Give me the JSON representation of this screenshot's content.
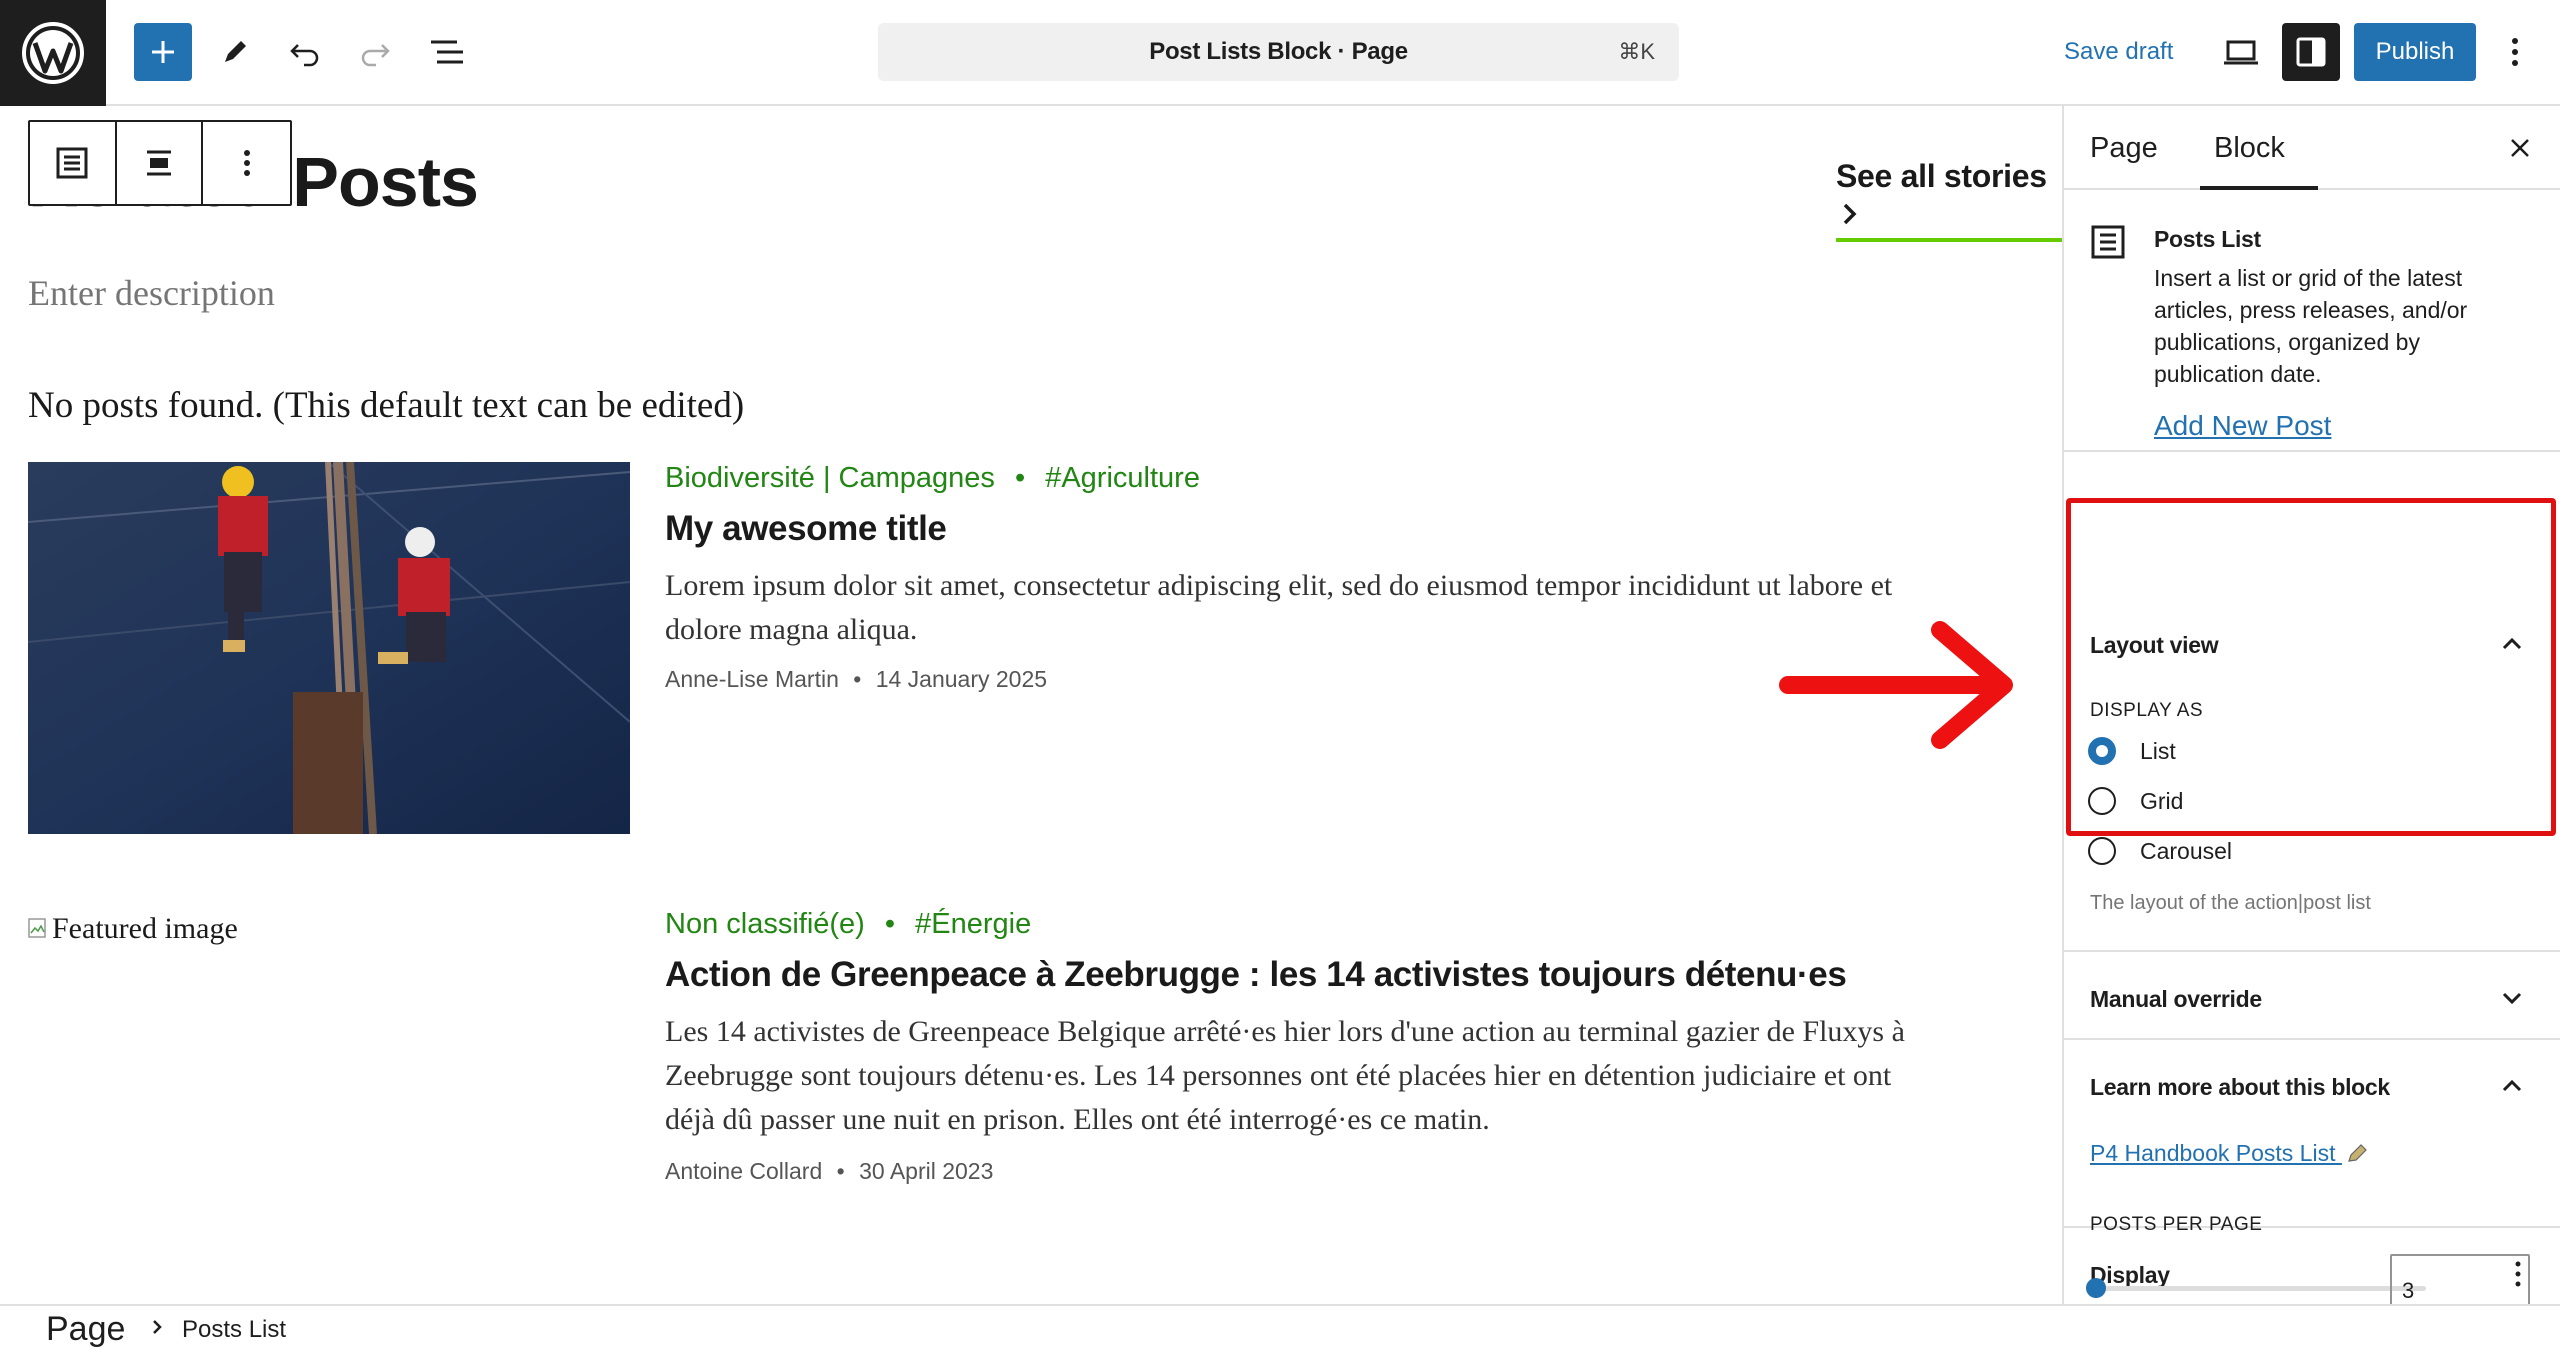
{
  "topbar": {
    "doc_title": "Post Lists Block · Page",
    "shortcut": "⌘K",
    "save_draft": "Save draft",
    "publish": "Publish"
  },
  "canvas": {
    "heading": "Related Posts",
    "see_all": "See all stories",
    "description_placeholder": "Enter description",
    "no_posts": "No posts found. (This default text can be edited)",
    "posts": [
      {
        "categories": "Biodiversité | Campagnes",
        "tag": "#Agriculture",
        "title": "My awesome title",
        "excerpt": "Lorem ipsum dolor sit amet, consectetur adipiscing elit, sed do eiusmod tempor incididunt ut labore et dolore magna aliqua.",
        "author": "Anne-Lise Martin",
        "date": "14 January 2025",
        "image": "activists-climbing-photo"
      },
      {
        "categories": "Non classifié(e)",
        "tag": "#Énergie",
        "title": "Action de Greenpeace à Zeebrugge : les 14 activistes toujours détenu·es",
        "excerpt": "Les 14 activistes de Greenpeace Belgique arrêté·es hier lors d'une action au terminal gazier de Fluxys à Zeebrugge sont toujours détenu·es. Les 14 personnes ont été placées hier en détention judiciaire et ont déjà dû passer une nuit en prison. Elles ont été interrogé·es ce matin.",
        "author": "Antoine Collard",
        "date": "30 April 2023",
        "image_alt": "Featured image"
      }
    ]
  },
  "sidebar": {
    "tabs": [
      "Page",
      "Block"
    ],
    "active_tab": "Block",
    "block_card": {
      "title": "Posts List",
      "description": "Insert a list or grid of the latest articles, press releases, and/or publications, organized by publication date.",
      "link": "Add New Post"
    },
    "layout_panel": {
      "title": "Layout view",
      "display_as_label": "DISPLAY AS",
      "options": [
        "List",
        "Grid",
        "Carousel"
      ],
      "selected": "List",
      "help": "The layout of the action|post list"
    },
    "manual_override": {
      "title": "Manual override"
    },
    "learn_more": {
      "title": "Learn more about this block",
      "link": "P4 Handbook Posts List"
    },
    "display": {
      "title": "Display",
      "posts_per_page_label": "POSTS PER PAGE",
      "posts_per_page": "3"
    }
  },
  "breadcrumb": {
    "root": "Page",
    "current": "Posts List"
  },
  "colors": {
    "accent": "#2271b1",
    "tag_green": "#218613",
    "highlight_red": "#e01010",
    "underline_green": "#66cc00"
  }
}
